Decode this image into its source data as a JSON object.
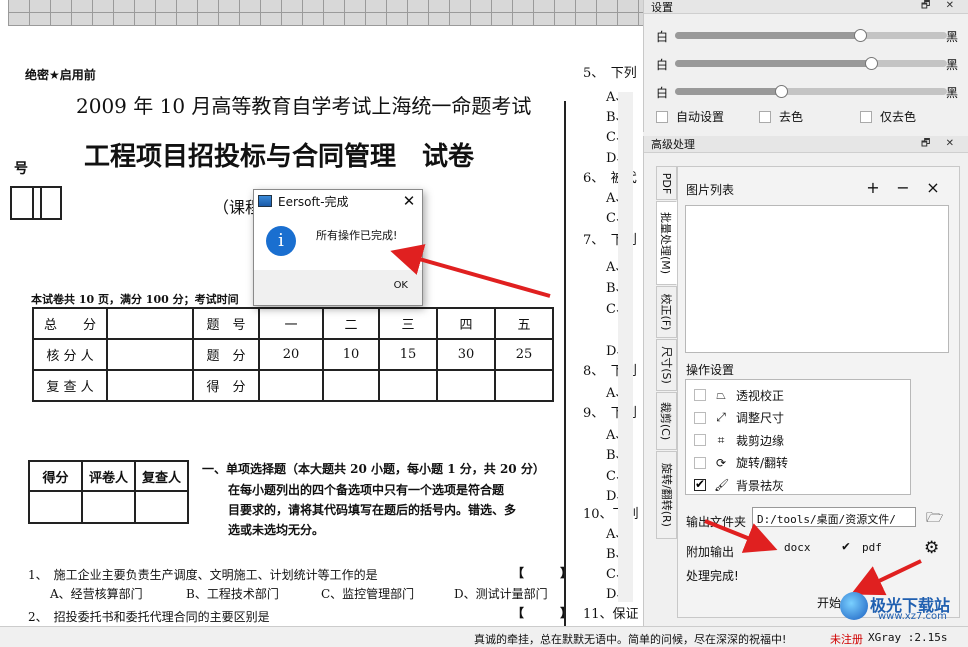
{
  "document": {
    "secret_tag": "绝密★启用前",
    "exam_header": "2009 年 10 月高等教育自学考试上海统一命题考试",
    "exam_title": "工程项目招投标与合同管理　试卷",
    "course_fragment": "（课程",
    "side_label": "号",
    "score_note": "本试卷共 10 页，满分 100 分；考试时间",
    "score_table": {
      "row1": [
        "总　　分",
        "",
        "题　号",
        "一",
        "二",
        "三",
        "四",
        "五"
      ],
      "row2": [
        "核 分 人",
        "",
        "题　分",
        "20",
        "10",
        "15",
        "30",
        "25"
      ],
      "row3": [
        "复 查 人",
        "",
        "得　分",
        "",
        "",
        "",
        "",
        ""
      ]
    },
    "grader_table": {
      "headers": [
        "得分",
        "评卷人",
        "复查人"
      ]
    },
    "section_title": "一、单项选择题（本大题共 20 小题，每小题 1 分，共 20 分）",
    "section_body": [
      "在每小题列出的四个备选项中只有一个选项是符合题",
      "目要求的，请将其代码填写在题后的括号内。错选、多",
      "选或未选均无分。"
    ],
    "q1": "1、　施工企业主要负责生产调度、文明施工、计划统计等工作的是",
    "q1_bracket": "【　　　】",
    "q1_options": [
      "A、经营核算部门",
      "B、工程技术部门",
      "C、监控管理部门",
      "D、测试计量部门"
    ],
    "q2": "2、　招投委托书和委托代理合同的主要区别是",
    "right_col": [
      "5、　下列",
      "A、",
      "B、",
      "C、",
      "D、",
      "6、　被代",
      "A、",
      "C、",
      "7、　下列",
      "A、",
      "B、",
      "C、",
      "D、",
      "8、　下列",
      "A、",
      "9、　下列",
      "A、",
      "B、",
      "C、",
      "D、",
      "10、下列",
      "A、",
      "B、",
      "C、",
      "D、",
      "11、保证"
    ]
  },
  "dialog": {
    "title": "Eersoft-完成",
    "close_label": "✕",
    "message": "所有操作已完成!",
    "ok_label": "OK"
  },
  "settings_panel": {
    "title": "设置",
    "controls": "🗗 ✕",
    "sliders": [
      {
        "left": "白",
        "right": "黑",
        "value": 0.68
      },
      {
        "left": "白",
        "right": "黑",
        "value": 0.72
      },
      {
        "left": "白",
        "right": "黑",
        "value": 0.39
      }
    ],
    "checkboxes": [
      "自动设置",
      "去色",
      "仅去色"
    ]
  },
  "advanced_panel": {
    "title": "高级处理",
    "controls": "🗗 ✕",
    "tabs": [
      "PDF",
      "批量处理(M)",
      "校正(F)",
      "尺寸(S)",
      "裁剪(C)",
      "旋转/翻转(R)"
    ],
    "image_list_label": "图片列表",
    "add_label": "+",
    "remove_label": "−",
    "clear_label": "×",
    "ops_label": "操作设置",
    "ops": [
      {
        "label": "透视校正",
        "icon": "⏢",
        "checked": false
      },
      {
        "label": "调整尺寸",
        "icon": "⤢",
        "checked": false
      },
      {
        "label": "裁剪边缘",
        "icon": "⌗",
        "checked": false
      },
      {
        "label": "旋转/翻转",
        "icon": "⟳",
        "checked": false
      },
      {
        "label": "背景祛灰",
        "icon": "🖌",
        "checked": true
      }
    ],
    "output_folder_label": "输出文件夹",
    "output_folder_value": "D:/tools/桌面/资源文件/",
    "extra_output_label": "附加输出",
    "format_docx": "docx",
    "format_pdf": "pdf",
    "done_text": "处理完成!",
    "start_button": "开始处理"
  },
  "status_bar": {
    "message": "真诚的牵挂，总在默默无语中。简单的问候，尽在深深的祝福中!",
    "unregistered": "未注册",
    "version": "XGray :2.15s"
  },
  "watermark": {
    "title": "极光下载站",
    "url": "www.xz7.com"
  },
  "colors": {
    "arrow": "#e02020",
    "accent": "#1a6fd0",
    "unregistered": "#d00000"
  }
}
